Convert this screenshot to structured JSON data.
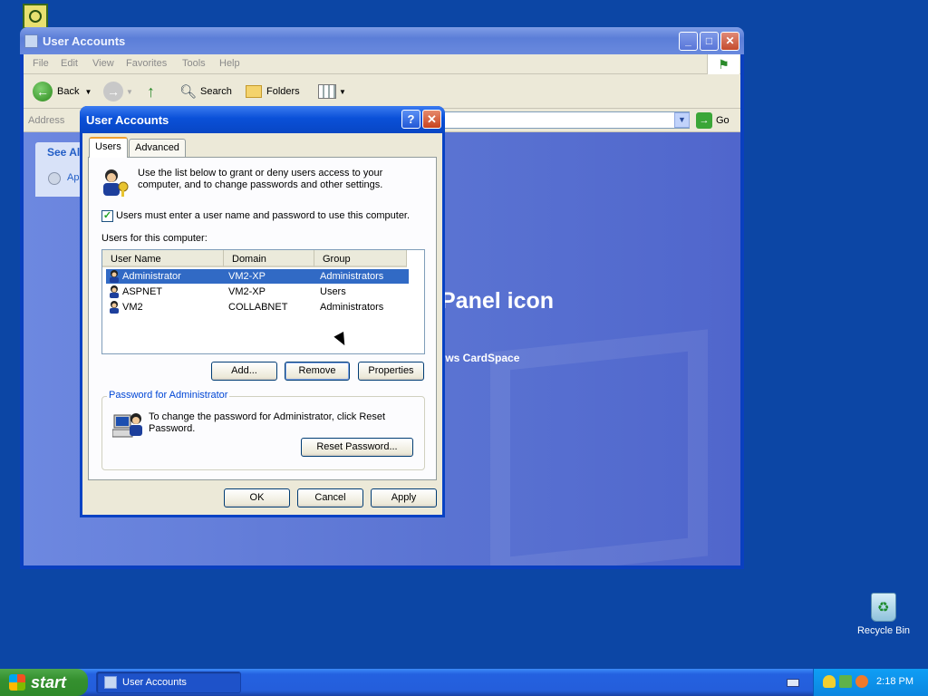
{
  "explorer": {
    "title": "User Accounts",
    "menu": [
      "File",
      "Edit",
      "View",
      "Favorites",
      "Tools",
      "Help"
    ],
    "toolbar": {
      "back": "Back",
      "search": "Search",
      "folders": "Folders"
    },
    "address_label": "Address",
    "go_label": "Go",
    "see_also": "See Als",
    "see_also_item": "Ap",
    "panel_text": "Panel icon",
    "cardspace": "ows CardSpace"
  },
  "dialog": {
    "title": "User Accounts",
    "tabs": [
      "Users",
      "Advanced"
    ],
    "intro": "Use the list below to grant or deny users access to your computer, and to change passwords and other settings.",
    "must_login_label": "Users must enter a user name and password to use this computer.",
    "must_login_checked": true,
    "users_for_label": "Users for this computer:",
    "columns": [
      "User Name",
      "Domain",
      "Group"
    ],
    "users": [
      {
        "name": "Administrator",
        "domain": "VM2-XP",
        "group": "Administrators",
        "selected": true
      },
      {
        "name": "ASPNET",
        "domain": "VM2-XP",
        "group": "Users",
        "selected": false
      },
      {
        "name": "VM2",
        "domain": "COLLABNET",
        "group": "Administrators",
        "selected": false
      }
    ],
    "buttons": {
      "add": "Add...",
      "remove": "Remove",
      "properties": "Properties",
      "reset": "Reset Password...",
      "ok": "OK",
      "cancel": "Cancel",
      "apply": "Apply"
    },
    "password_group_label": "Password for Administrator",
    "password_text": "To change the password for Administrator, click Reset Password."
  },
  "desktop": {
    "recycle_bin": "Recycle Bin"
  },
  "taskbar": {
    "start": "start",
    "task": "User Accounts",
    "clock": "2:18 PM"
  }
}
